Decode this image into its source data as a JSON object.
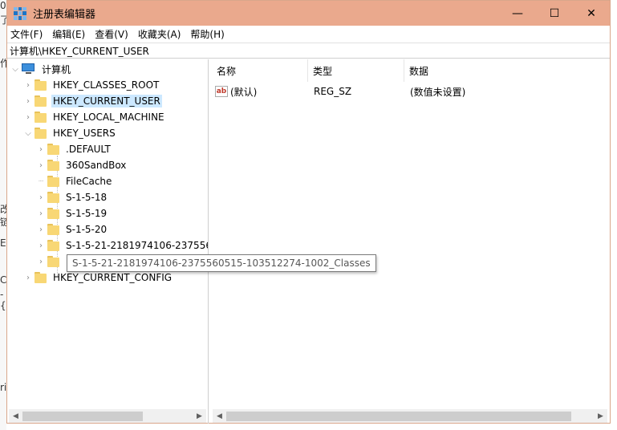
{
  "window": {
    "title": "注册表编辑器",
    "controls": {
      "minimize": "—",
      "maximize": "☐",
      "close": "✕"
    }
  },
  "menu": [
    "文件(F)",
    "编辑(E)",
    "查看(V)",
    "收藏夹(A)",
    "帮助(H)"
  ],
  "address": "计算机\\HKEY_CURRENT_USER",
  "tree": {
    "root": "计算机",
    "nodes": [
      {
        "label": "HKEY_CLASSES_ROOT",
        "level": 1,
        "state": "collapsed"
      },
      {
        "label": "HKEY_CURRENT_USER",
        "level": 1,
        "state": "collapsed",
        "selected": true
      },
      {
        "label": "HKEY_LOCAL_MACHINE",
        "level": 1,
        "state": "collapsed"
      },
      {
        "label": "HKEY_USERS",
        "level": 1,
        "state": "expanded"
      },
      {
        "label": ".DEFAULT",
        "level": 2,
        "state": "collapsed"
      },
      {
        "label": "360SandBox",
        "level": 2,
        "state": "collapsed"
      },
      {
        "label": "FileCache",
        "level": 2,
        "state": "leaf"
      },
      {
        "label": "S-1-5-18",
        "level": 2,
        "state": "collapsed"
      },
      {
        "label": "S-1-5-19",
        "level": 2,
        "state": "collapsed"
      },
      {
        "label": "S-1-5-20",
        "level": 2,
        "state": "collapsed"
      },
      {
        "label": "S-1-5-21-2181974106-2375560",
        "level": 2,
        "state": "collapsed"
      },
      {
        "label": "",
        "level": 2,
        "state": "collapsed"
      },
      {
        "label": "HKEY_CURRENT_CONFIG",
        "level": 1,
        "state": "collapsed"
      }
    ]
  },
  "tooltip": "S-1-5-21-2181974106-2375560515-103512274-1002_Classes",
  "list": {
    "columns": [
      "名称",
      "类型",
      "数据"
    ],
    "rows": [
      {
        "name": "(默认)",
        "type": "REG_SZ",
        "data": "(数值未设置)",
        "icon": "ab-string-icon"
      }
    ]
  },
  "background_chars": [
    "0",
    "了",
    "作",
    "改",
    "链",
    "E",
    "Cu",
    "-{",
    "ri"
  ]
}
